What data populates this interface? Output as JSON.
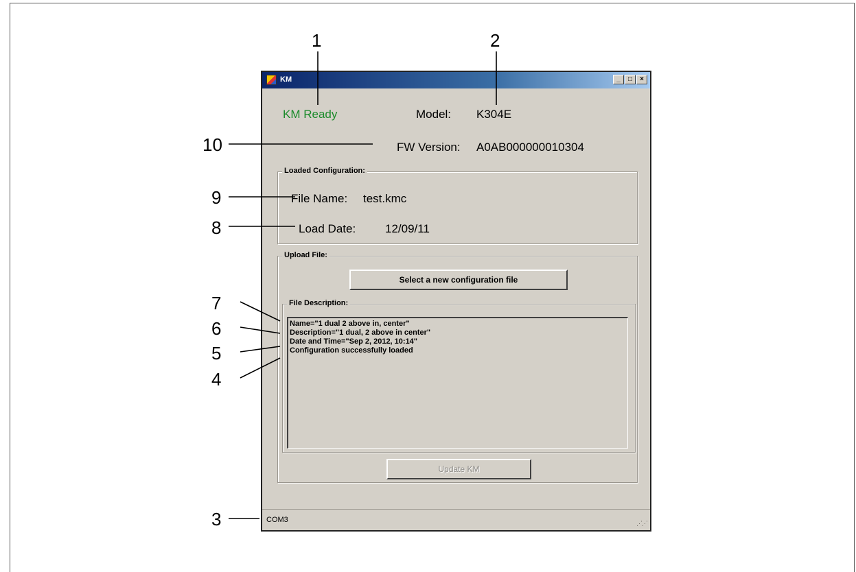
{
  "window": {
    "title": "KM",
    "controls": [
      "_",
      "□",
      "×"
    ],
    "status": "KM Ready",
    "model_label": "Model:",
    "model_value": "K304E",
    "fw_label": "FW Version:",
    "fw_value": "A0AB000000010304",
    "loaded_config": {
      "title": "Loaded Configuration:",
      "file_name_label": "File Name:",
      "file_name_value": "test.kmc",
      "load_date_label": "Load Date:",
      "load_date_value": "12/09/11"
    },
    "upload": {
      "title": "Upload File:",
      "select_button": "Select a new configuration file",
      "description_title": "File Description:",
      "lines": [
        "Name=\"1 dual 2 above in, center\"",
        "Description=\"1 dual, 2 above in center\"",
        "Date and Time=\"Sep 2, 2012, 10:14\"",
        "Configuration successfully loaded"
      ],
      "update_button": "Update KM"
    },
    "statusbar_text": "COM3",
    "colors": {
      "ready": "#1a8a2a",
      "titlebar": "#0a246a"
    }
  },
  "callouts": [
    "1",
    "2",
    "3",
    "4",
    "5",
    "6",
    "7",
    "8",
    "9",
    "10"
  ]
}
